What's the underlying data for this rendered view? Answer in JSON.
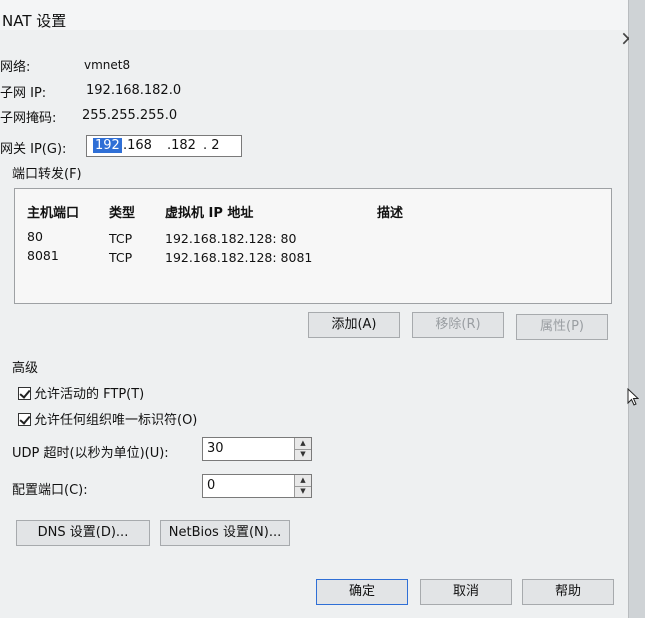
{
  "dialog": {
    "title": "NAT 设置",
    "close_glyph": "×",
    "network_label": "网络:",
    "network_value": "vmnet8",
    "subnet_ip_label": "子网 IP:",
    "subnet_ip_value": "192.168.182.0",
    "subnet_mask_label": "子网掩码:",
    "subnet_mask_value": "255.255.255.0",
    "gateway_label": "网关 IP(G):",
    "gateway": {
      "seg1": "192",
      "seg2": ".168",
      "seg3": ".182",
      "seg4": ".  2"
    }
  },
  "port_forwarding": {
    "label": "端口转发(F)",
    "columns": [
      "主机端口",
      "类型",
      "虚拟机 IP 地址",
      "描述"
    ],
    "rows": [
      {
        "host_port": "80",
        "type": "TCP",
        "vm_ip": "192.168.182.128: 80",
        "desc": ""
      },
      {
        "host_port": "8081",
        "type": "TCP",
        "vm_ip": "192.168.182.128: 8081",
        "desc": ""
      }
    ],
    "add_label": "添加(A)",
    "remove_label": "移除(R)",
    "properties_label": "属性(P)"
  },
  "advanced": {
    "label": "高级",
    "allow_ftp_label": "允许活动的 FTP(T)",
    "allow_ftp_checked": true,
    "allow_any_oui_label": "允许任何组织唯一标识符(O)",
    "allow_any_oui_checked": true,
    "udp_timeout_label": "UDP 超时(以秒为单位)(U):",
    "udp_timeout_value": "30",
    "config_port_label": "配置端口(C):",
    "config_port_value": "0",
    "dns_button": "DNS 设置(D)...",
    "netbios_button": "NetBios 设置(N)..."
  },
  "footer": {
    "ok": "确定",
    "cancel": "取消",
    "help": "帮助"
  },
  "colors": {
    "selection": "#2f6fd6",
    "dialog_bg": "#eef0f1",
    "disabled_text": "#9a9ea2"
  }
}
